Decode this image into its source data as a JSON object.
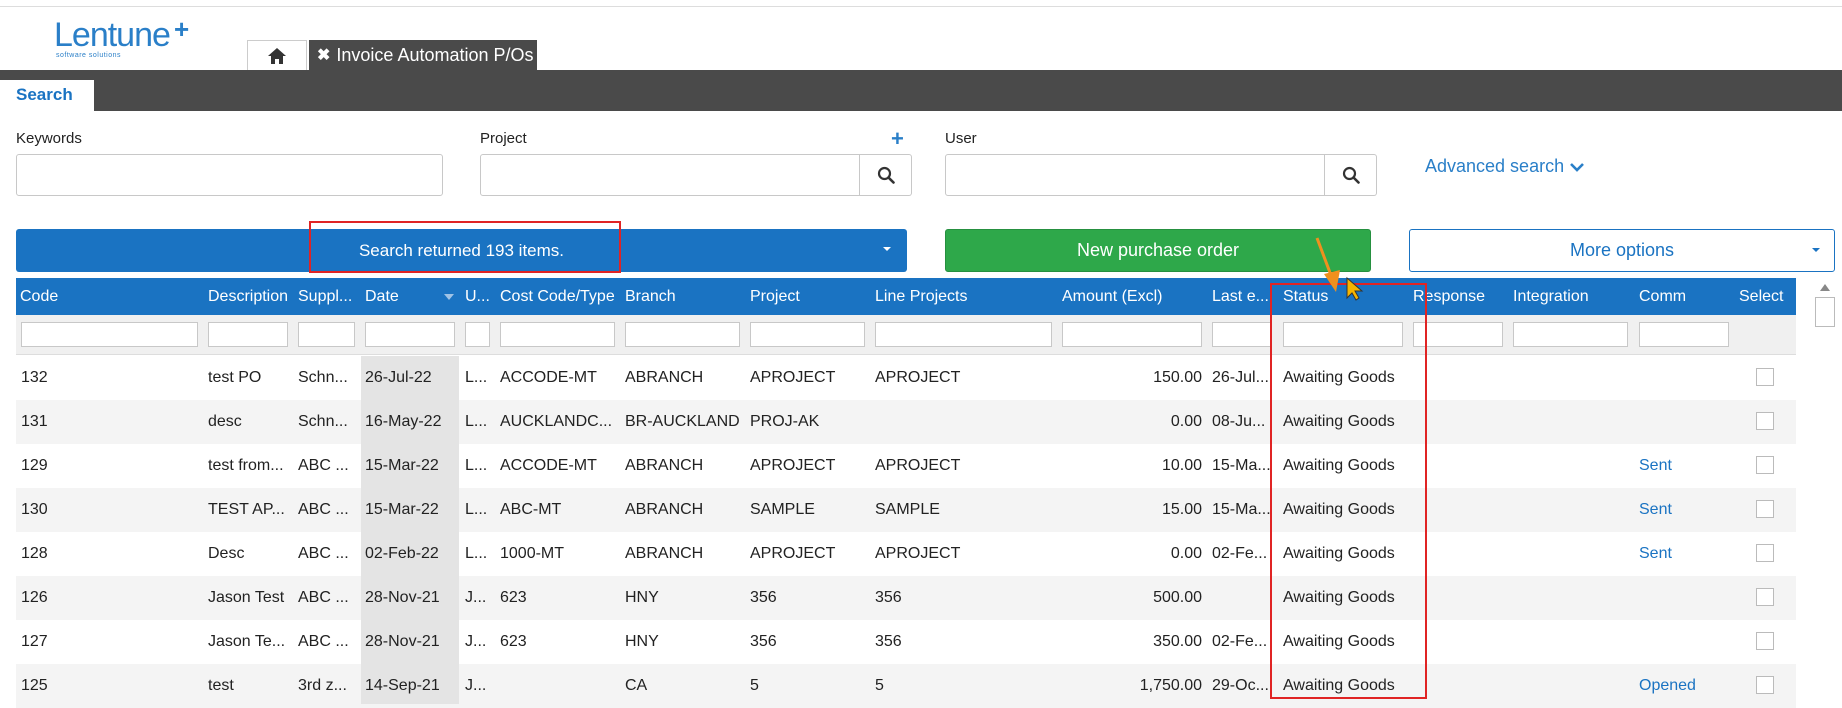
{
  "brand": {
    "name": "Lentune",
    "plus": "+",
    "tagline": "software solutions"
  },
  "tabs": {
    "active_label": "Invoice Automation P/Os"
  },
  "search_tab": "Search",
  "filters": {
    "keywords_label": "Keywords",
    "project_label": "Project",
    "user_label": "User",
    "advanced_label": "Advanced search"
  },
  "actions": {
    "result_text": "Search returned 193 items.",
    "new_po_label": "New purchase order",
    "more_options_label": "More options"
  },
  "columns": [
    "Code",
    "Description",
    "Suppl...",
    "Date",
    "U...",
    "Cost Code/Type",
    "Branch",
    "Project",
    "Line Projects",
    "Amount (Excl)",
    "Last e...",
    "Status",
    "Response",
    "Integration",
    "Comm",
    "Select"
  ],
  "rows": [
    {
      "code": "132",
      "description": "test PO",
      "supplier": "Schn...",
      "date": "26-Jul-22",
      "user": "L...",
      "cost_code": "ACCODE-MT",
      "branch": "ABRANCH",
      "project": "APROJECT",
      "line_projects": "APROJECT",
      "amount": "150.00",
      "last": "26-Jul...",
      "status": "Awaiting Goods",
      "comm": ""
    },
    {
      "code": "131",
      "description": "desc",
      "supplier": "Schn...",
      "date": "16-May-22",
      "user": "L...",
      "cost_code": "AUCKLANDC...",
      "branch": "BR-AUCKLAND",
      "project": "PROJ-AK",
      "line_projects": "",
      "amount": "0.00",
      "last": "08-Ju...",
      "status": "Awaiting Goods",
      "comm": ""
    },
    {
      "code": "129",
      "description": "test from...",
      "supplier": "ABC ...",
      "date": "15-Mar-22",
      "user": "L...",
      "cost_code": "ACCODE-MT",
      "branch": "ABRANCH",
      "project": "APROJECT",
      "line_projects": "APROJECT",
      "amount": "10.00",
      "last": "15-Ma...",
      "status": "Awaiting Goods",
      "comm": "Sent"
    },
    {
      "code": "130",
      "description": "TEST AP...",
      "supplier": "ABC ...",
      "date": "15-Mar-22",
      "user": "L...",
      "cost_code": "ABC-MT",
      "branch": "ABRANCH",
      "project": "SAMPLE",
      "line_projects": "SAMPLE",
      "amount": "15.00",
      "last": "15-Ma...",
      "status": "Awaiting Goods",
      "comm": "Sent"
    },
    {
      "code": "128",
      "description": "Desc",
      "supplier": "ABC ...",
      "date": "02-Feb-22",
      "user": "L...",
      "cost_code": "1000-MT",
      "branch": "ABRANCH",
      "project": "APROJECT",
      "line_projects": "APROJECT",
      "amount": "0.00",
      "last": "02-Fe...",
      "status": "Awaiting Goods",
      "comm": "Sent"
    },
    {
      "code": "126",
      "description": "Jason Test",
      "supplier": "ABC ...",
      "date": "28-Nov-21",
      "user": "J...",
      "cost_code": "623",
      "branch": "HNY",
      "project": "356",
      "line_projects": "356",
      "amount": "500.00",
      "last": "",
      "status": "Awaiting Goods",
      "comm": ""
    },
    {
      "code": "127",
      "description": "Jason Te...",
      "supplier": "ABC ...",
      "date": "28-Nov-21",
      "user": "J...",
      "cost_code": "623",
      "branch": "HNY",
      "project": "356",
      "line_projects": "356",
      "amount": "350.00",
      "last": "02-Fe...",
      "status": "Awaiting Goods",
      "comm": ""
    },
    {
      "code": "125",
      "description": "test",
      "supplier": "3rd z...",
      "date": "14-Sep-21",
      "user": "J...",
      "cost_code": "",
      "branch": "CA",
      "project": "5",
      "line_projects": "5",
      "amount": "1,750.00",
      "last": "29-Oc...",
      "status": "Awaiting Goods",
      "comm": "Opened"
    }
  ],
  "colors": {
    "accent": "#1a73c2",
    "green": "#2ea84a",
    "header_dark": "#4a4a4a",
    "highlight": "#e02424",
    "arrow": "#f0901e"
  }
}
